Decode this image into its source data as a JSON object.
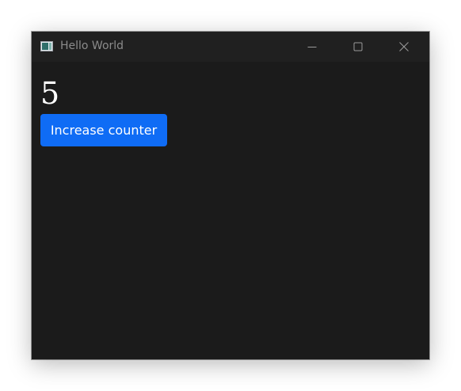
{
  "window": {
    "title": "Hello World",
    "icon": "application-window-icon",
    "controls": [
      "minimize-icon",
      "maximize-icon",
      "close-icon"
    ]
  },
  "content": {
    "counter_value": "5",
    "button_label": "Increase counter"
  },
  "colors": {
    "window_background": "#1b1b1b",
    "titlebar_background": "#202020",
    "button_accent": "#0f6cf5",
    "title_text": "#8b8b8b",
    "counter_text": "#ffffff"
  }
}
